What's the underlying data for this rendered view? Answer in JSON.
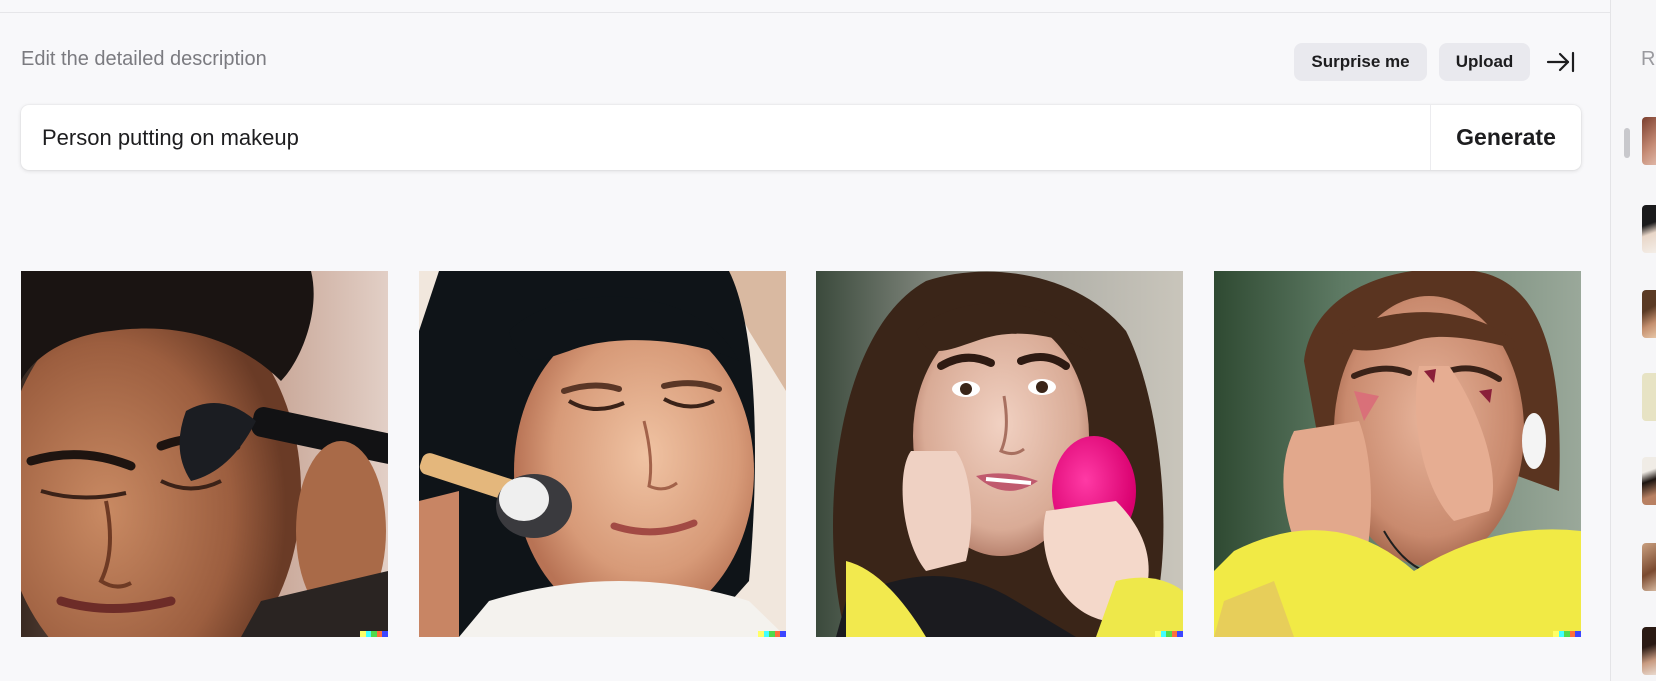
{
  "header": {
    "description_label": "Edit the detailed description",
    "surprise_label": "Surprise me",
    "upload_label": "Upload",
    "collapse_icon": "arrow-right-to-bar-icon"
  },
  "prompt": {
    "value": "Person putting on makeup",
    "generate_label": "Generate"
  },
  "results": [
    {
      "name": "result-image-1",
      "subject": "man-with-eyeshadow-brush"
    },
    {
      "name": "result-image-2",
      "subject": "woman-with-blush-brush"
    },
    {
      "name": "result-image-3",
      "subject": "woman-with-pink-sponge"
    },
    {
      "name": "result-image-4",
      "subject": "woman-touching-face"
    }
  ],
  "signature_colors": [
    "#ffff66",
    "#42ffff",
    "#51da4c",
    "#ff6e3c",
    "#3c46ff"
  ],
  "sidebar": {
    "heading_initial": "R",
    "history_count": 7
  }
}
